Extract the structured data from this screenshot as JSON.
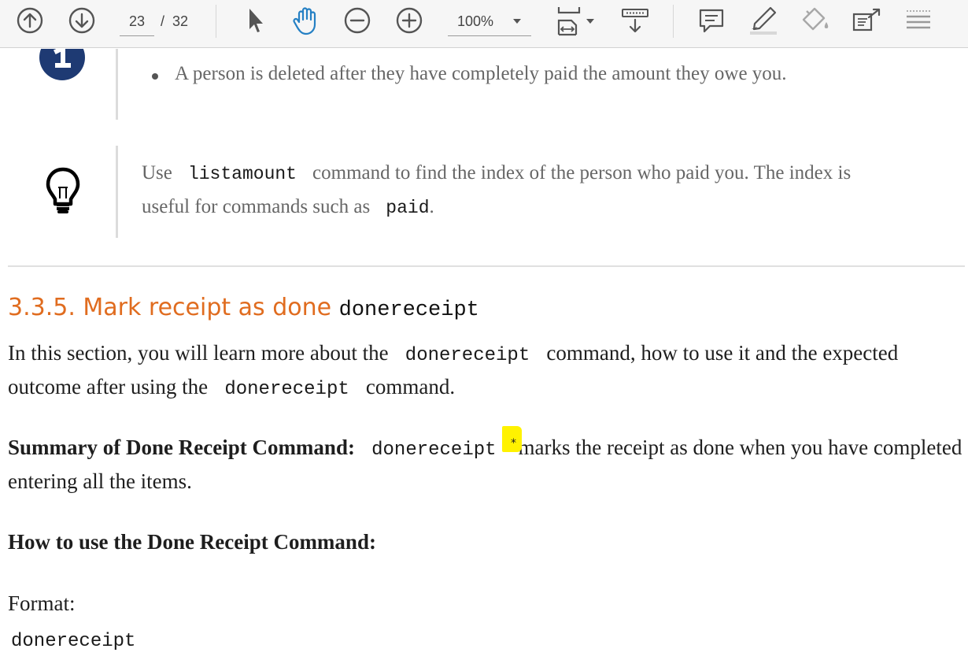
{
  "toolbar": {
    "page_current": "23",
    "page_sep": "/",
    "page_total": "32",
    "zoom_value": "100%",
    "icons": [
      "prev-page-icon",
      "next-page-icon",
      "select-tool-icon",
      "hand-tool-icon",
      "zoom-out-icon",
      "zoom-in-icon",
      "fit-page-icon",
      "scroll-mode-icon",
      "comment-icon",
      "highlight-icon",
      "fill-sign-icon",
      "share-icon",
      "more-tools-icon"
    ],
    "accent": "#2580c4"
  },
  "notes": {
    "info_bullet": "A person is deleted after they have completely paid the amount they owe you.",
    "tip_prefix": "Use",
    "tip_cmd1": "listamount",
    "tip_middle": "command to find the index of the person who paid you. The index is",
    "tip_line2_prefix": "useful for commands such as",
    "tip_cmd2": "paid",
    "tip_end": "."
  },
  "section": {
    "heading_text": "3.3.5. Mark receipt as done",
    "heading_cmd": "donereceipt",
    "heading_color": "#e06c1f",
    "intro_prefix": "In this section, you will learn more about the",
    "intro_cmd": "donereceipt",
    "intro_suffix": "command, how to use it and the expected",
    "intro2_prefix": "outcome after using the",
    "intro2_cmd": "donereceipt",
    "intro2_suffix": "command.",
    "summary_label": "Summary of Done Receipt Command:",
    "summary_cmd": "donereceipt",
    "summary_suffix": "marks the receipt as done when you have completed",
    "summary_line2": "entering all the items.",
    "howto_label": "How to use the Done Receipt Command:",
    "format_label": "Format:",
    "format_cmd": "donereceipt",
    "sticky_symbol": "*",
    "sticky_color": "#fff200"
  }
}
